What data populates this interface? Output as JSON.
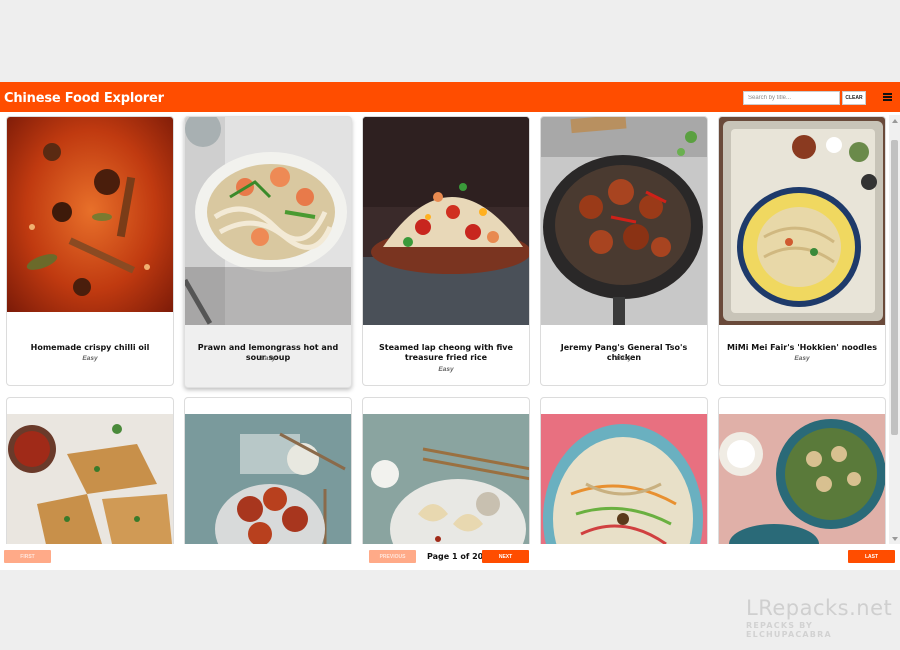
{
  "app": {
    "title": "Chinese Food Explorer"
  },
  "search": {
    "placeholder": "Search by title...",
    "value": ""
  },
  "clear_label": "CLEAR",
  "recipes": [
    {
      "title": "Homemade crispy chilli oil",
      "difficulty": "Easy"
    },
    {
      "title": "Prawn and lemongrass hot and sour soup",
      "difficulty": "Easy"
    },
    {
      "title": "Steamed lap cheong with five treasure fried rice",
      "difficulty": "Easy"
    },
    {
      "title": "Jeremy Pang's General Tso's chicken",
      "difficulty": "Easy"
    },
    {
      "title": "MiMi Mei Fair's 'Hokkien' noodles",
      "difficulty": "Easy"
    }
  ],
  "pagination": {
    "first": "FIRST",
    "previous": "PREVIOUS",
    "page_label": "Page 1 of 20",
    "next": "NEXT",
    "last": "LAST"
  },
  "watermark": {
    "line1": "LRepacks.net",
    "line2": "REPACKS BY ELCHUPACABRA"
  },
  "colors": {
    "accent": "#ff4d00",
    "accent_disabled": "#ffaa88",
    "background": "#eeeeee"
  }
}
